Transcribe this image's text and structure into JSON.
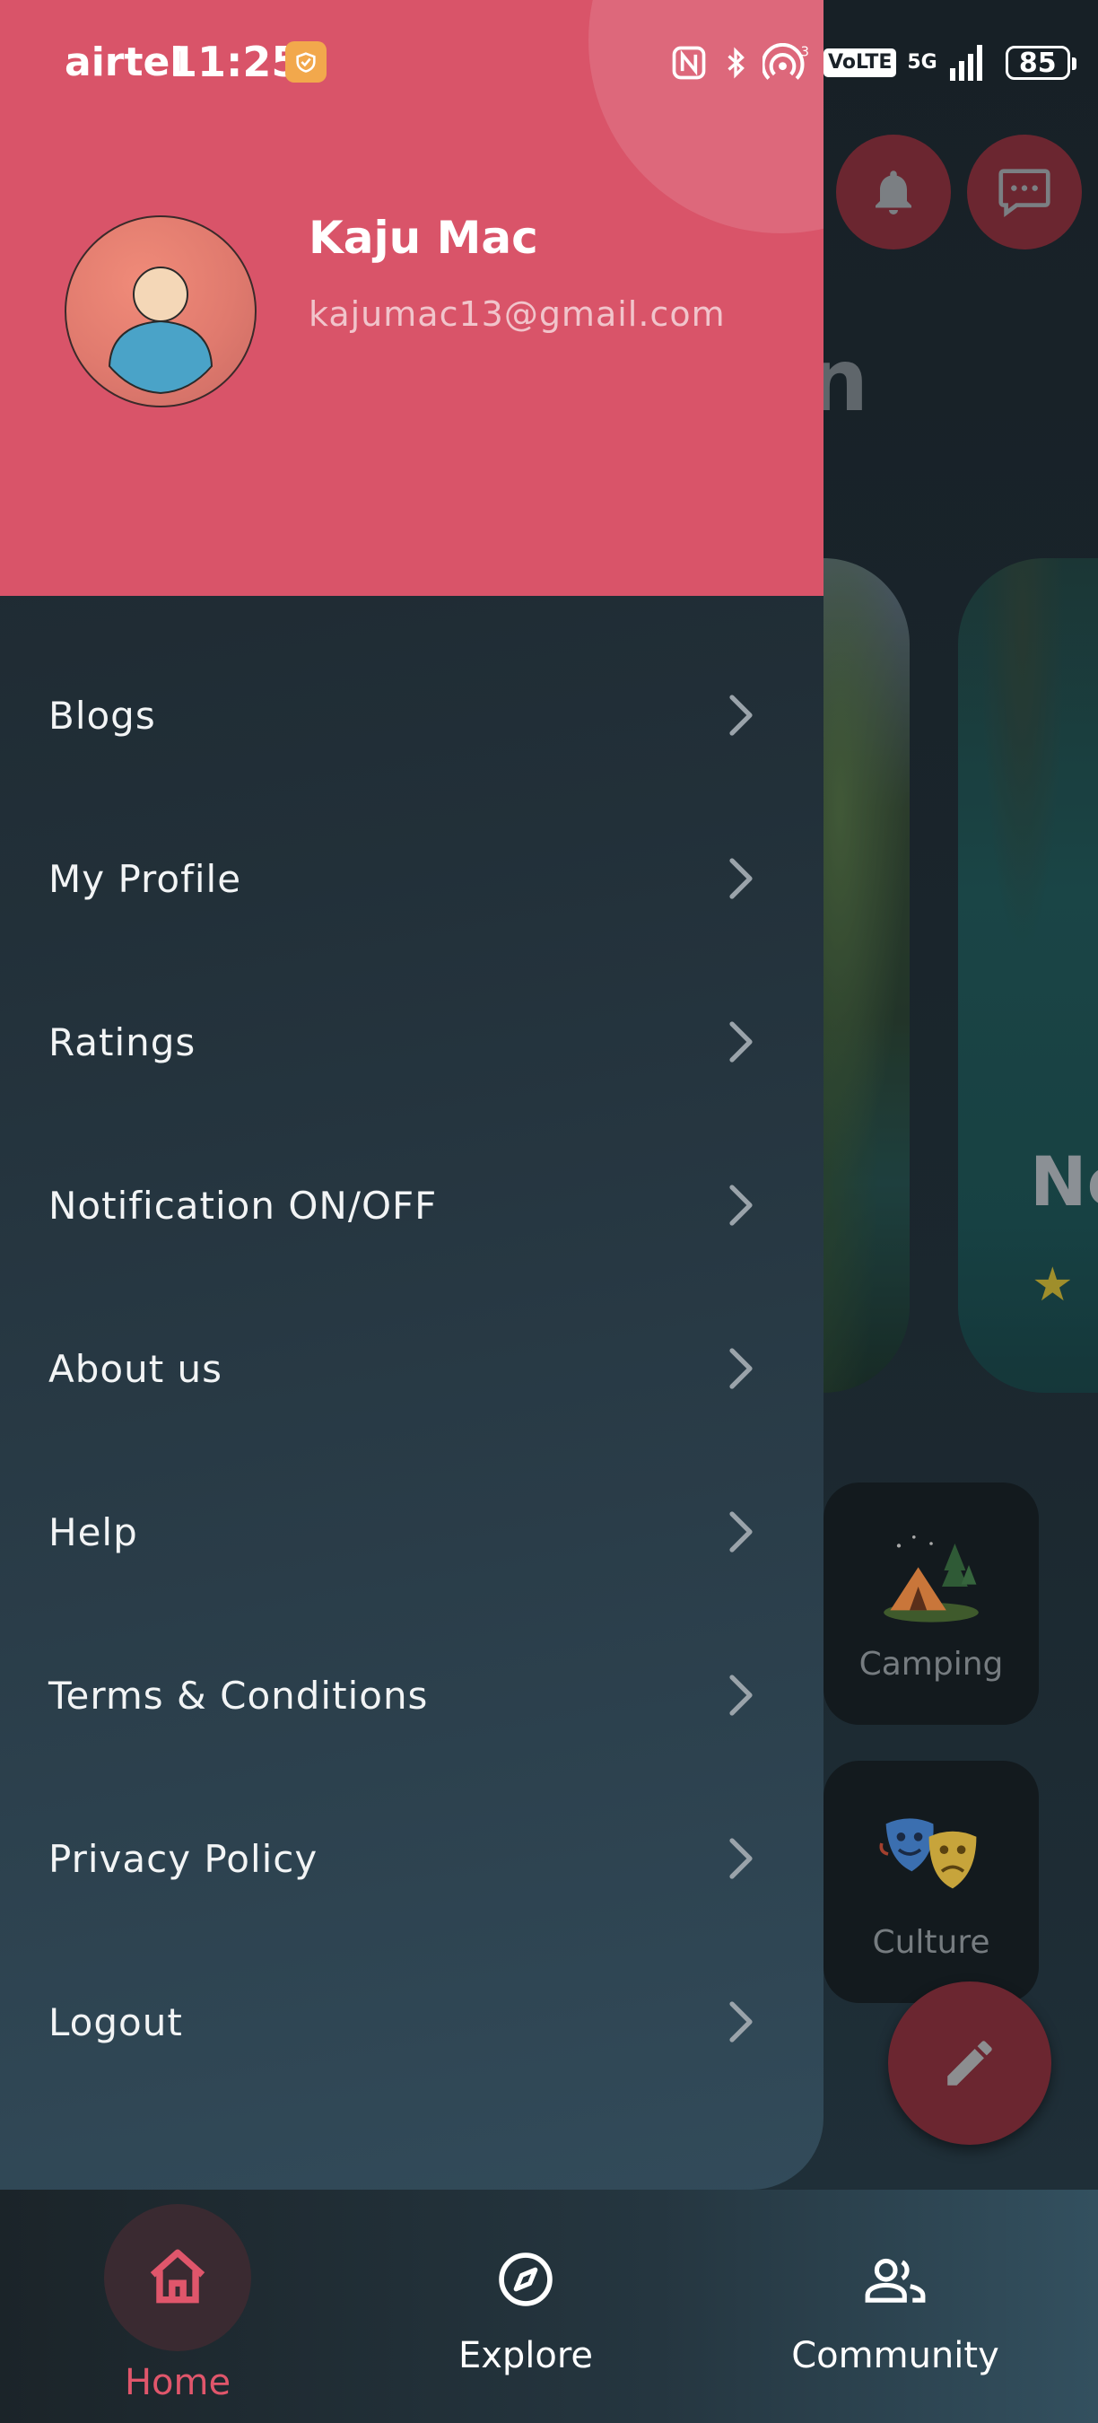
{
  "status_bar": {
    "carrier": "airtel",
    "time": "11:25",
    "volte": "VoLTE",
    "network": "5G",
    "battery": "85"
  },
  "drawer": {
    "profile": {
      "name": "Kaju Mac",
      "email": "kajumac13@gmail.com"
    },
    "menu": [
      {
        "label": "Blogs"
      },
      {
        "label": "My Profile"
      },
      {
        "label": "Ratings"
      },
      {
        "label": "Notification ON/OFF"
      },
      {
        "label": "About us"
      },
      {
        "label": "Help"
      },
      {
        "label": "Terms & Conditions"
      },
      {
        "label": "Privacy Policy"
      },
      {
        "label": "Logout"
      }
    ]
  },
  "background": {
    "heading_fragment": "n",
    "card_title_fragment": "Ne",
    "categories": [
      {
        "label": "Camping",
        "icon": "tent-icon"
      },
      {
        "label": "Culture",
        "icon": "theater-masks-icon"
      }
    ]
  },
  "bottom_nav": {
    "items": [
      {
        "label": "Home",
        "icon": "home-icon",
        "active": true
      },
      {
        "label": "Explore",
        "icon": "compass-icon",
        "active": false
      },
      {
        "label": "Community",
        "icon": "people-icon",
        "active": false
      }
    ]
  },
  "colors": {
    "accent": "#d95469",
    "active_nav": "#e0566b",
    "drawer_bg": "#223039"
  }
}
